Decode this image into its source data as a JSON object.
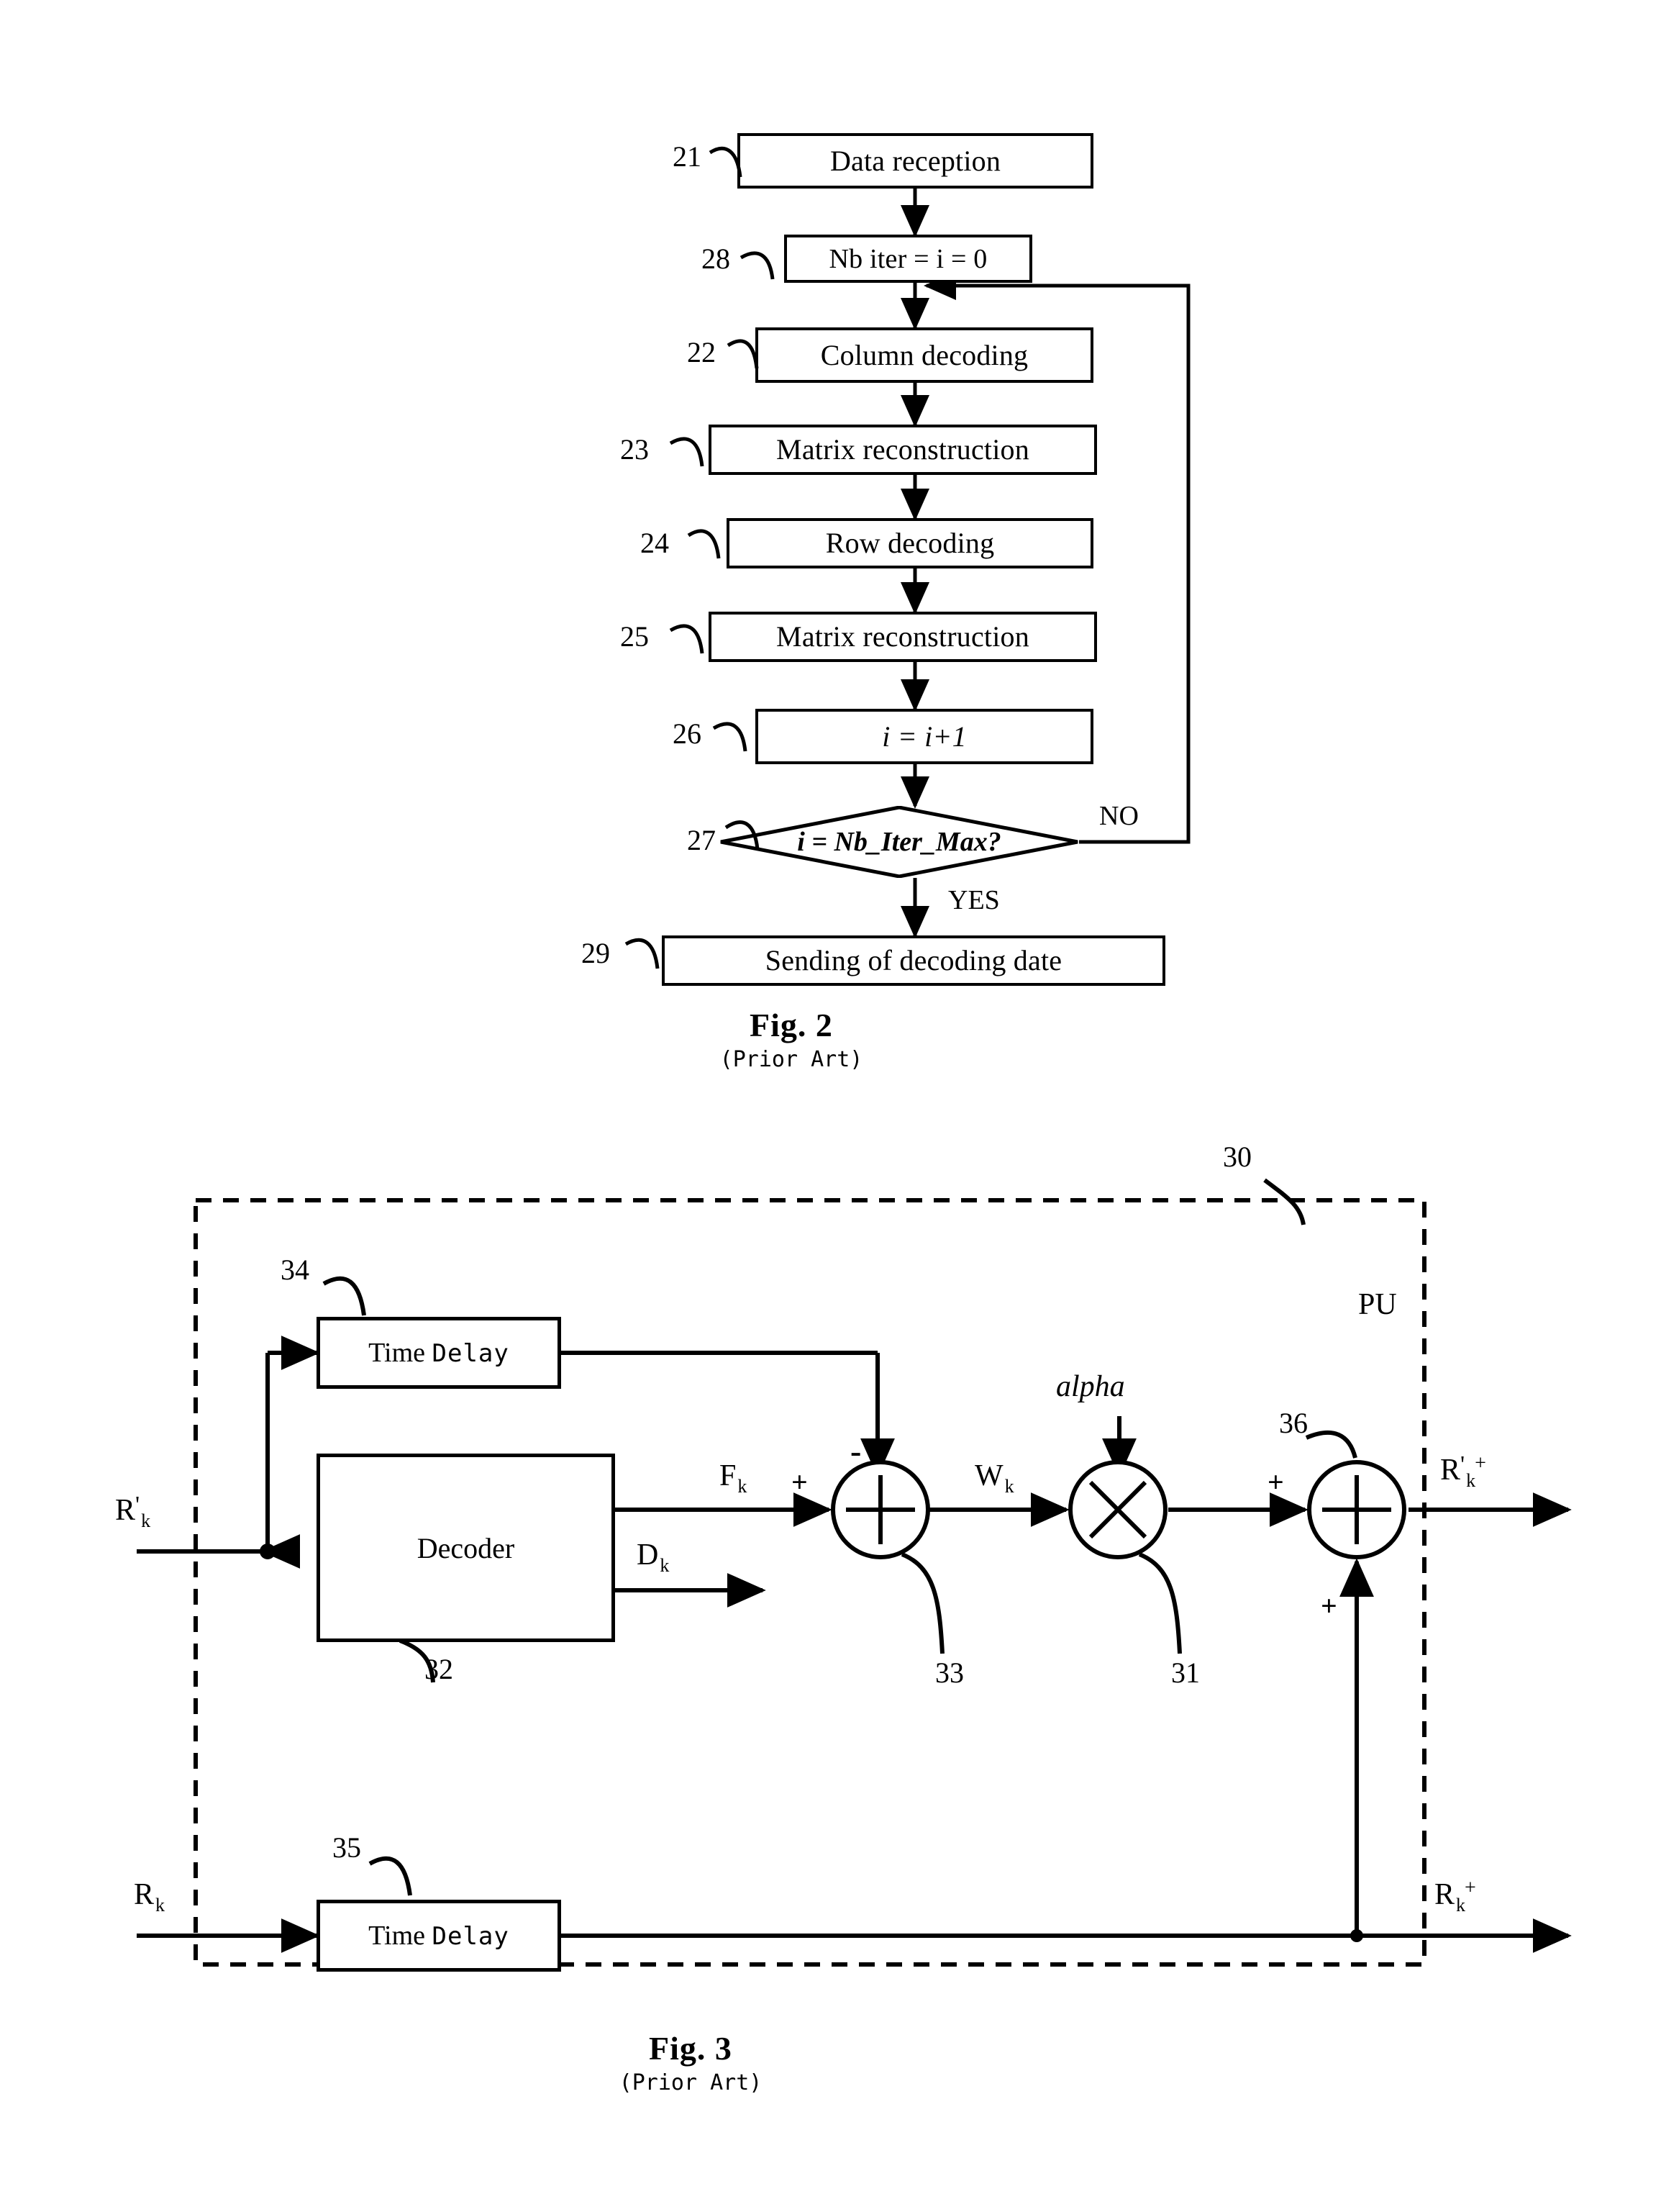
{
  "figures": [
    {
      "id": "fig2",
      "caption_title": "Fig. 2",
      "caption_sub": "(Prior Art)",
      "type": "flowchart",
      "nodes": [
        {
          "ref": "21",
          "label": "Data reception",
          "shape": "process"
        },
        {
          "ref": "28",
          "label": "Nb iter = i = 0",
          "shape": "process"
        },
        {
          "ref": "22",
          "label": "Column decoding",
          "shape": "process"
        },
        {
          "ref": "23",
          "label": "Matrix reconstruction",
          "shape": "process"
        },
        {
          "ref": "24",
          "label": "Row decoding",
          "shape": "process"
        },
        {
          "ref": "25",
          "label": "Matrix reconstruction",
          "shape": "process"
        },
        {
          "ref": "26",
          "label": "i = i+1",
          "shape": "process"
        },
        {
          "ref": "27",
          "label": "i = Nb_Iter_Max?",
          "shape": "decision"
        },
        {
          "ref": "29",
          "label": "Sending of decoding date",
          "shape": "process"
        }
      ],
      "branches": {
        "no": "NO",
        "yes": "YES"
      }
    },
    {
      "id": "fig3",
      "caption_title": "Fig. 3",
      "caption_sub": "(Prior Art)",
      "type": "block-diagram",
      "enclosure_ref": "30",
      "enclosure_label": "PU",
      "blocks": [
        {
          "ref": "34",
          "label_a": "Time",
          "label_b": "Delay",
          "kind": "time-delay"
        },
        {
          "ref": "32",
          "label_a": "Decoder",
          "label_b": "",
          "kind": "decoder"
        },
        {
          "ref": "33",
          "label_a": "",
          "label_b": "",
          "kind": "adder"
        },
        {
          "ref": "31",
          "label_a": "",
          "label_b": "",
          "kind": "multiplier"
        },
        {
          "ref": "36",
          "label_a": "",
          "label_b": "",
          "kind": "adder"
        },
        {
          "ref": "35",
          "label_a": "Time",
          "label_b": "Delay",
          "kind": "time-delay"
        }
      ],
      "signals": {
        "input_primary": {
          "base": "R",
          "prime": "'",
          "sub": "k",
          "sup": ""
        },
        "input_secondary": {
          "base": "R",
          "prime": "",
          "sub": "k",
          "sup": ""
        },
        "decoder_out_soft": {
          "base": "F",
          "prime": "",
          "sub": "k",
          "sup": ""
        },
        "decoder_out_hard": {
          "base": "D",
          "prime": "",
          "sub": "k",
          "sup": ""
        },
        "extrinsic": {
          "base": "W",
          "prime": "",
          "sub": "k",
          "sup": ""
        },
        "output_primary": {
          "base": "R",
          "prime": "'",
          "sub": "k",
          "sup": "+"
        },
        "output_secondary": {
          "base": "R",
          "prime": "",
          "sub": "k",
          "sup": "+"
        },
        "scaling_factor": "alpha"
      },
      "operator_signs": {
        "adder33_plus": "+",
        "adder33_minus": "-",
        "adder36_plus_left": "+",
        "adder36_plus_bottom": "+"
      }
    }
  ]
}
